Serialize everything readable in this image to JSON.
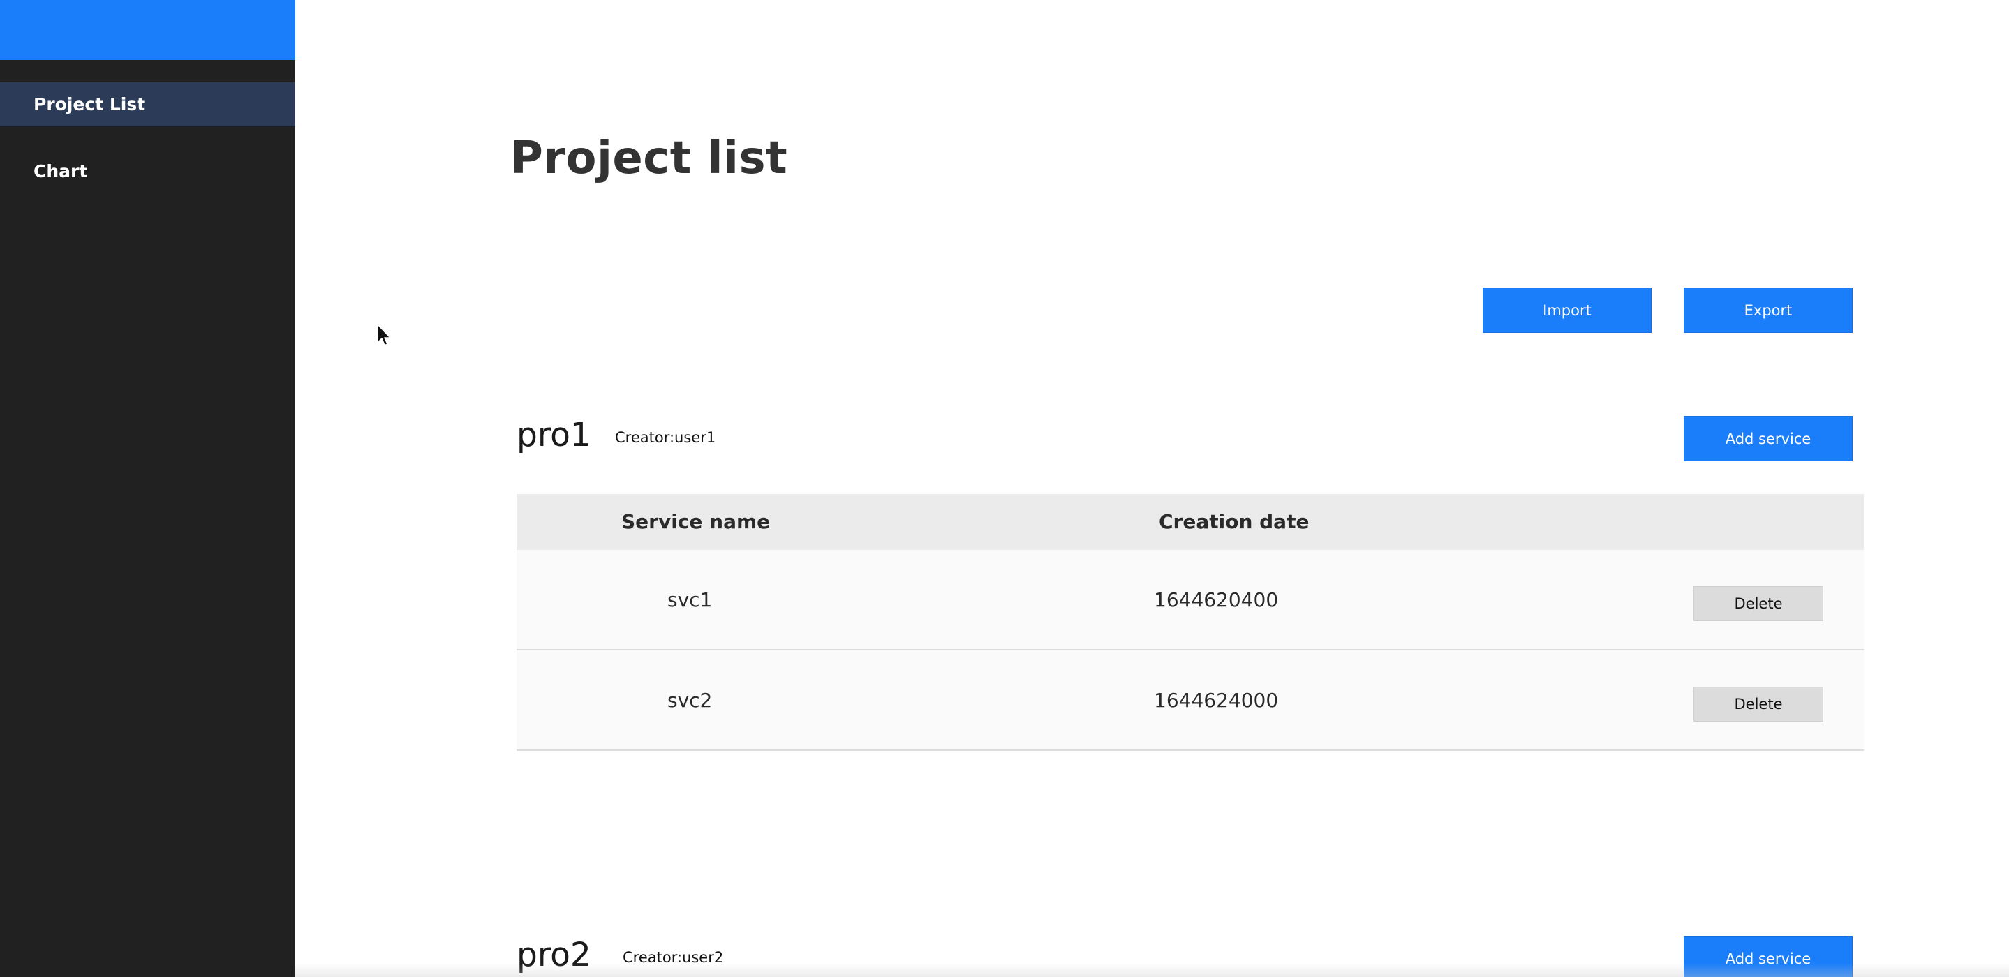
{
  "sidebar": {
    "items": [
      {
        "label": "Project List",
        "active": true
      },
      {
        "label": "Chart",
        "active": false
      }
    ]
  },
  "main": {
    "title": "Project list",
    "import_label": "Import",
    "export_label": "Export"
  },
  "projects": [
    {
      "name": "pro1",
      "creator": "Creator:user1",
      "add_label": "Add service",
      "columns": [
        "Service name",
        "Creation date"
      ],
      "services": [
        {
          "name": "svc1",
          "date": "1644620400",
          "delete_label": "Delete"
        },
        {
          "name": "svc2",
          "date": "1644624000",
          "delete_label": "Delete"
        }
      ]
    },
    {
      "name": "pro2",
      "creator": "Creator:user2",
      "add_label": "Add service"
    }
  ],
  "colors": {
    "accent": "#1a7efb",
    "sidebar_bg": "#212121",
    "sidebar_active": "#2b3b58"
  }
}
